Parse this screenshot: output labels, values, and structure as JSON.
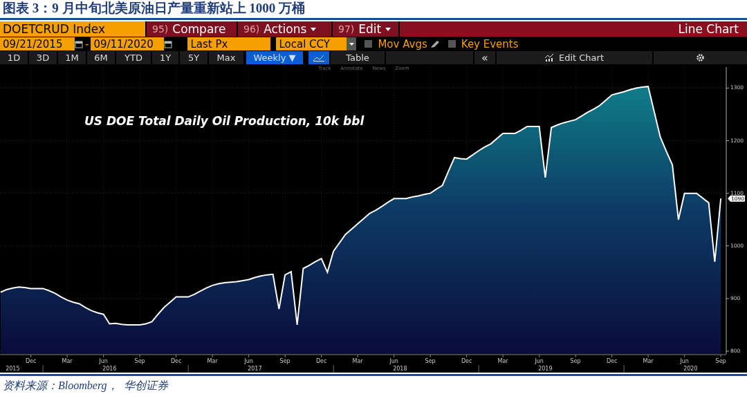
{
  "report_title": "图表 3：9 月中旬北美原油日产量重新站上 1000 万桶",
  "terminal": {
    "header": {
      "security": "DOETCRUD Index",
      "menus": [
        {
          "number": "95)",
          "label": "Compare",
          "dropdown": false
        },
        {
          "number": "96)",
          "label": "Actions",
          "dropdown": true
        },
        {
          "number": "97)",
          "label": "Edit",
          "dropdown": true
        }
      ],
      "view_title": "Line Chart"
    },
    "settings": {
      "start_date": "09/21/2015",
      "separator": "-",
      "end_date": "09/11/2020",
      "price_field": "Last Px",
      "currency": "Local CCY",
      "options": [
        {
          "label": "Mov Avgs",
          "checked": false,
          "editable": true
        },
        {
          "label": "Key Events",
          "checked": false,
          "editable": false
        }
      ]
    },
    "ranges": [
      {
        "label": "1D",
        "selected": false
      },
      {
        "label": "3D",
        "selected": false
      },
      {
        "label": "1M",
        "selected": false
      },
      {
        "label": "6M",
        "selected": false
      },
      {
        "label": "YTD",
        "selected": false
      },
      {
        "label": "1Y",
        "selected": false
      },
      {
        "label": "5Y",
        "selected": false
      },
      {
        "label": "Max",
        "selected": false
      }
    ],
    "frequency": {
      "label": "Weekly ▼",
      "selected": true
    },
    "table_button": "Table",
    "collapse_button": "«",
    "edit_chart": "Edit Chart",
    "chart_tools": [
      "Track",
      "Annotate",
      "News",
      "Zoom"
    ],
    "chart": {
      "annotation": "US DOE Total Daily Oil Production, 10k bbl",
      "last_value": "1090",
      "years": [
        "2015",
        "2016",
        "2017",
        "2018",
        "2019",
        "2020"
      ],
      "chart_data": {
        "type": "area",
        "categories": [
          null,
          null,
          null,
          null,
          null,
          "Dec",
          null,
          null,
          null,
          null,
          null,
          "Mar",
          null,
          null,
          null,
          null,
          null,
          "Jun",
          null,
          null,
          null,
          null,
          null,
          "Sep",
          null,
          null,
          null,
          null,
          null,
          "Dec",
          null,
          null,
          null,
          null,
          null,
          "Mar",
          null,
          null,
          null,
          null,
          null,
          "Jun",
          null,
          null,
          null,
          null,
          null,
          "Sep",
          null,
          null,
          null,
          null,
          null,
          "Dec",
          null,
          null,
          null,
          null,
          null,
          "Mar",
          null,
          null,
          null,
          null,
          null,
          "Jun",
          null,
          null,
          null,
          null,
          null,
          "Sep",
          null,
          null,
          null,
          null,
          null,
          "Dec",
          null,
          null,
          null,
          null,
          null,
          "Mar",
          null,
          null,
          null,
          null,
          null,
          "Jun",
          null,
          null,
          null,
          null,
          null,
          "Sep",
          null,
          null,
          null,
          null,
          null,
          "Dec",
          null,
          null,
          null,
          null,
          null,
          "Mar",
          null,
          null,
          null,
          null,
          null,
          "Jun",
          null,
          null,
          null,
          null,
          null,
          "Sep"
        ],
        "series": [
          {
            "color": "#ffffff",
            "values": [
              912,
              917,
              920,
              922,
              921,
              919,
              919,
              919,
              915,
              910,
              903,
              897,
              893,
              890,
              883,
              877,
              873,
              870,
              852,
              853,
              851,
              850,
              850,
              850,
              852,
              856,
              870,
              883,
              893,
              903,
              903,
              903,
              908,
              914,
              920,
              925,
              928,
              930,
              931,
              932,
              934,
              936,
              940,
              943,
              945,
              946,
              880,
              945,
              951,
              850,
              957,
              963,
              970,
              976,
              950,
              990,
              1006,
              1022,
              1032,
              1042,
              1052,
              1062,
              1068,
              1075,
              1083,
              1090,
              1090,
              1090,
              1093,
              1095,
              1098,
              1100,
              1108,
              1115,
              1142,
              1168,
              1166,
              1165,
              1173,
              1181,
              1188,
              1194,
              1204,
              1214,
              1214,
              1214,
              1220,
              1227,
              1227,
              1227,
              1130,
              1225,
              1230,
              1234,
              1237,
              1240,
              1247,
              1254,
              1260,
              1267,
              1277,
              1287,
              1290,
              1293,
              1297,
              1300,
              1302,
              1303,
              1255,
              1207,
              1180,
              1154,
              1050,
              1100,
              1100,
              1100,
              1091,
              1082,
              970,
              1090
            ]
          }
        ],
        "ylim": [
          800,
          1340
        ],
        "yticks": [
          800,
          900,
          1000,
          1100,
          1200,
          1300
        ],
        "grid": true
      }
    }
  },
  "source": "资料来源：Bloomberg，  华创证券"
}
